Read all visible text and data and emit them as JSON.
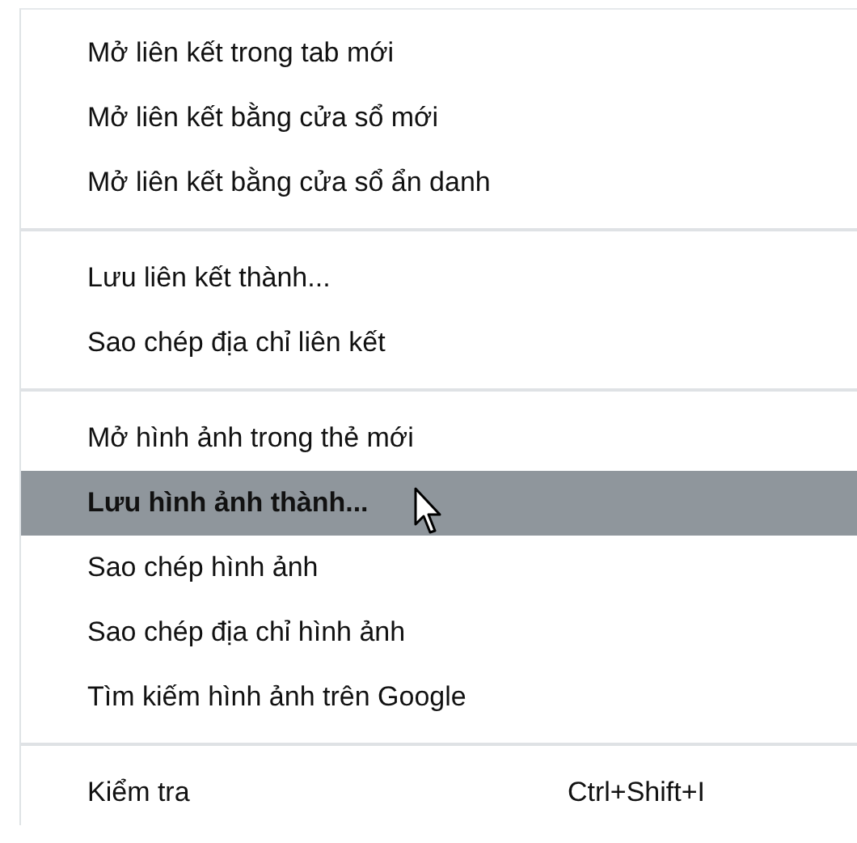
{
  "menu": {
    "sections": [
      {
        "items": [
          {
            "label": "Mở liên kết trong tab mới",
            "selected": false
          },
          {
            "label": "Mở liên kết bằng cửa sổ mới",
            "selected": false
          },
          {
            "label": "Mở liên kết bằng cửa sổ ẩn danh",
            "selected": false
          }
        ]
      },
      {
        "items": [
          {
            "label": "Lưu liên kết thành...",
            "selected": false
          },
          {
            "label": "Sao chép địa chỉ liên kết",
            "selected": false
          }
        ]
      },
      {
        "items": [
          {
            "label": "Mở hình ảnh trong thẻ mới",
            "selected": false
          },
          {
            "label": "Lưu hình ảnh thành...",
            "selected": true
          },
          {
            "label": "Sao chép hình ảnh",
            "selected": false
          },
          {
            "label": "Sao chép địa chỉ hình ảnh",
            "selected": false
          },
          {
            "label": "Tìm kiếm hình ảnh trên Google",
            "selected": false
          }
        ]
      },
      {
        "items": [
          {
            "label": "Kiểm tra",
            "shortcut": "Ctrl+Shift+I",
            "selected": false
          }
        ]
      }
    ]
  }
}
